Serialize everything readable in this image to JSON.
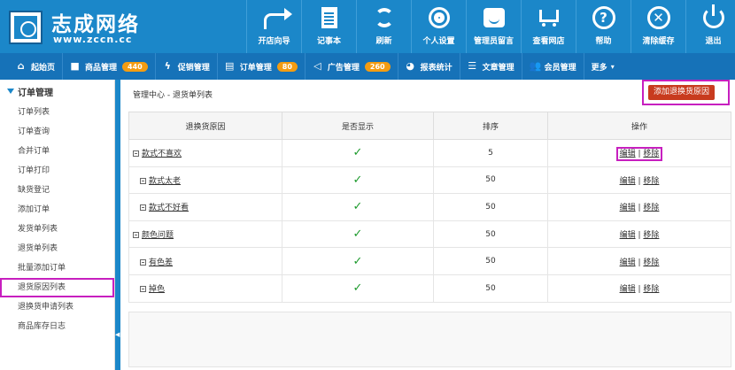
{
  "brand": {
    "name": "志成网络",
    "url": "www.zccn.cc"
  },
  "topnav": [
    {
      "label": "开店向导",
      "icon": "arrow-icon"
    },
    {
      "label": "记事本",
      "icon": "notebook-icon"
    },
    {
      "label": "刷新",
      "icon": "refresh-icon"
    },
    {
      "label": "个人设置",
      "icon": "gear-icon"
    },
    {
      "label": "管理员留言",
      "icon": "message-icon"
    },
    {
      "label": "查看网店",
      "icon": "cart-icon"
    },
    {
      "label": "帮助",
      "icon": "help-icon",
      "glyph": "?"
    },
    {
      "label": "清除缓存",
      "icon": "clear-icon",
      "glyph": "✕"
    },
    {
      "label": "退出",
      "icon": "power-icon"
    }
  ],
  "subnav": [
    {
      "label": "起始页",
      "icon": "home-icon",
      "glyph": "⌂"
    },
    {
      "label": "商品管理",
      "icon": "folder-icon",
      "glyph": "■",
      "badge": "440"
    },
    {
      "label": "促销管理",
      "icon": "bolt-icon",
      "glyph": "ϟ"
    },
    {
      "label": "订单管理",
      "icon": "clipboard-icon",
      "glyph": "▤",
      "badge": "80"
    },
    {
      "label": "广告管理",
      "icon": "megaphone-icon",
      "glyph": "◁",
      "badge": "260"
    },
    {
      "label": "报表统计",
      "icon": "pie-icon",
      "glyph": "◕"
    },
    {
      "label": "文章管理",
      "icon": "list-icon",
      "glyph": "☰"
    },
    {
      "label": "会员管理",
      "icon": "users-icon",
      "glyph": "👥"
    },
    {
      "label": "更多",
      "icon": "more-icon",
      "caret": "▾"
    }
  ],
  "sidebar": {
    "title": "订单管理",
    "items": [
      "订单列表",
      "订单查询",
      "合并订单",
      "订单打印",
      "缺货登记",
      "添加订单",
      "发货单列表",
      "退货单列表",
      "批量添加订单",
      "退货原因列表",
      "退换货申请列表",
      "商品库存日志"
    ],
    "active_index": 9
  },
  "breadcrumb": "管理中心  -  退货单列表",
  "add_button": "添加退换货原因",
  "table": {
    "headers": [
      "退换货原因",
      "是否显示",
      "排序",
      "操作"
    ],
    "rows": [
      {
        "name": "款式不喜欢",
        "level": 0,
        "show": "✓",
        "sort": "5",
        "edit": "编辑",
        "sep": "|",
        "remove": "移除"
      },
      {
        "name": "款式太老",
        "level": 1,
        "show": "✓",
        "sort": "50",
        "edit": "编辑",
        "sep": "|",
        "remove": "移除"
      },
      {
        "name": "款式不好看",
        "level": 1,
        "show": "✓",
        "sort": "50",
        "edit": "编辑",
        "sep": "|",
        "remove": "移除"
      },
      {
        "name": "颜色问题",
        "level": 0,
        "show": "✓",
        "sort": "50",
        "edit": "编辑",
        "sep": "|",
        "remove": "移除"
      },
      {
        "name": "有色差",
        "level": 1,
        "show": "✓",
        "sort": "50",
        "edit": "编辑",
        "sep": "|",
        "remove": "移除"
      },
      {
        "name": "掉色",
        "level": 1,
        "show": "✓",
        "sort": "50",
        "edit": "编辑",
        "sep": "|",
        "remove": "移除"
      }
    ]
  },
  "colors": {
    "header_blue": "#1b87c9",
    "subnav_blue": "#1672b8",
    "badge_orange": "#f39c12",
    "add_button_red": "#c83b1e",
    "check_green": "#1c9a2c",
    "highlight_magenta": "#c71fbf"
  }
}
